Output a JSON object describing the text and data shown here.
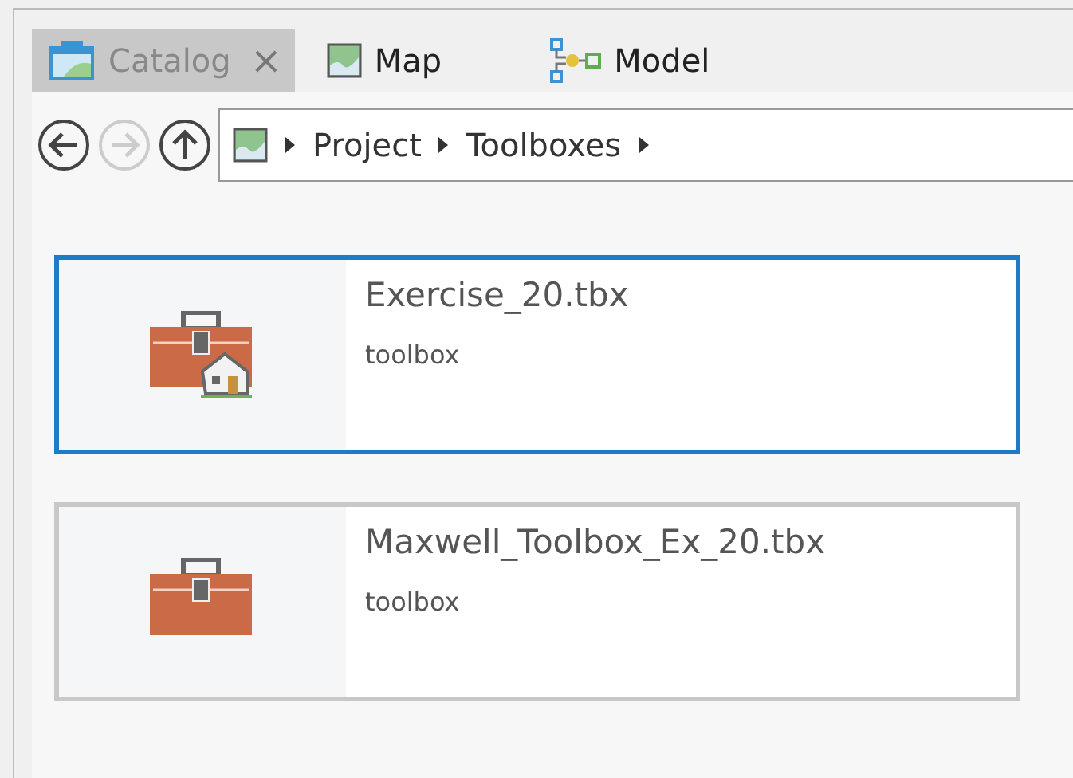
{
  "tabs": [
    {
      "label": "Catalog",
      "kind": "catalog",
      "selected": true,
      "closable": true
    },
    {
      "label": "Map",
      "kind": "map",
      "selected": false,
      "closable": false
    },
    {
      "label": "Model",
      "kind": "model",
      "selected": false,
      "closable": false
    }
  ],
  "close_glyph": "×",
  "nav_buttons": [
    {
      "kind": "back",
      "disabled": false
    },
    {
      "kind": "forward",
      "disabled": true
    },
    {
      "kind": "up",
      "disabled": false
    }
  ],
  "breadcrumb": [
    "Project",
    "Toolboxes"
  ],
  "items": [
    {
      "name": "Exercise_20.tbx",
      "type": "toolbox",
      "home": true,
      "selected": true
    },
    {
      "name": "Maxwell_Toolbox_Ex_20.tbx",
      "type": "toolbox",
      "home": false,
      "selected": false
    }
  ]
}
